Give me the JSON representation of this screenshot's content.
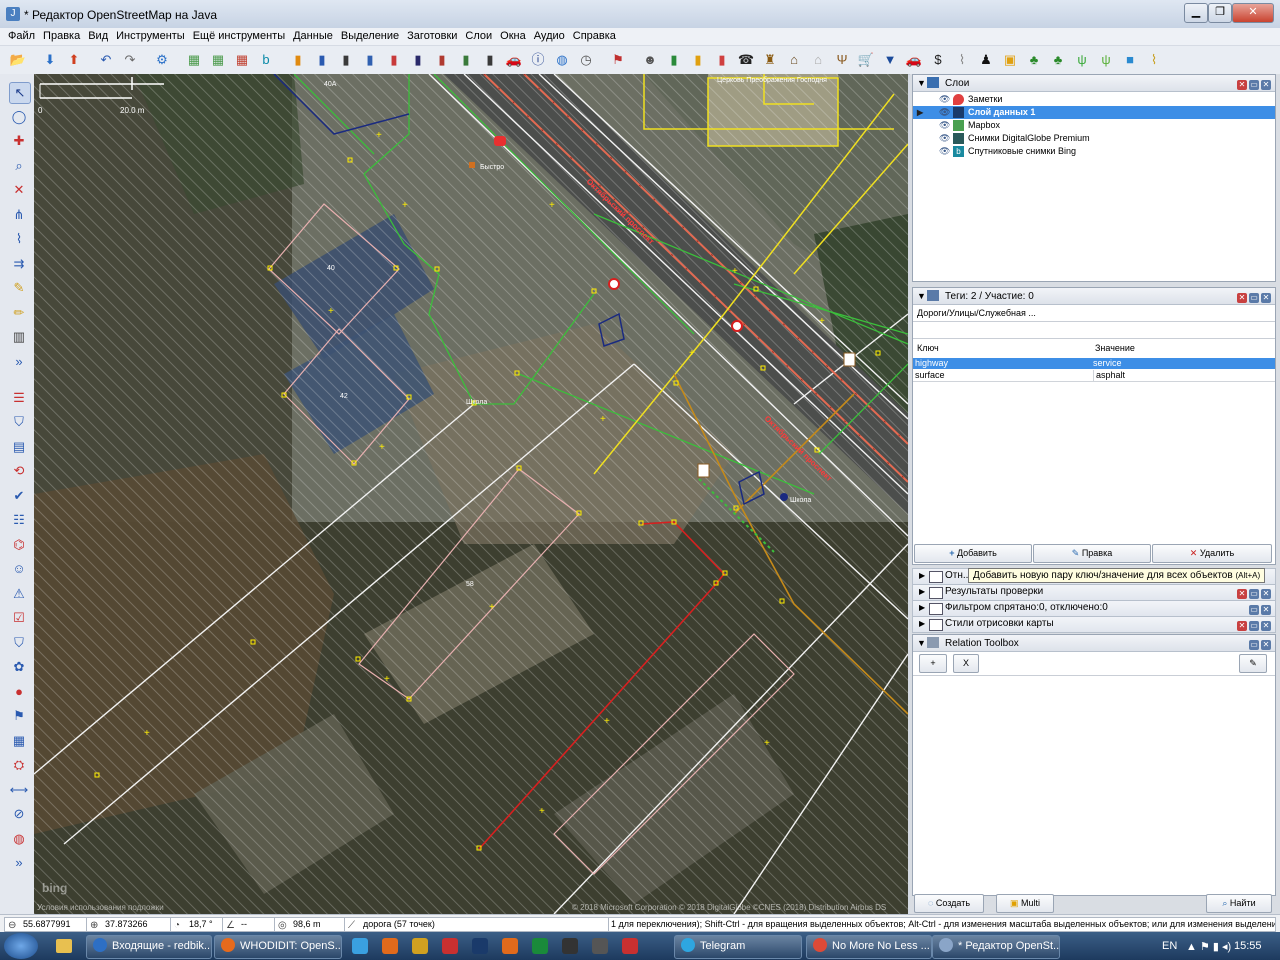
{
  "window": {
    "title": "* Редактор OpenStreetMap на Java",
    "app_icon": "josm-icon",
    "controls": [
      "minimize",
      "maximize",
      "close"
    ]
  },
  "menu": [
    "Файл",
    "Правка",
    "Вид",
    "Инструменты",
    "Ещё инструменты",
    "Данные",
    "Выделение",
    "Заготовки",
    "Слои",
    "Окна",
    "Аудио",
    "Справка"
  ],
  "toolbar_icons": [
    "open-icon",
    "download-icon",
    "upload-icon",
    "undo-icon",
    "redo-icon",
    "preferences-icon",
    "imagery-icon",
    "imagery-icon",
    "imagery-icon",
    "bing-icon",
    "preset-icon",
    "preset-icon",
    "preset-icon",
    "preset-icon",
    "preset-icon",
    "preset-icon",
    "preset-icon",
    "preset-icon",
    "preset-icon",
    "car-icon",
    "info-icon",
    "globe-icon",
    "clock-icon",
    "flag-icon",
    "theatre-icon",
    "preset-icon",
    "preset-icon",
    "preset-icon",
    "phone-icon",
    "castle-icon",
    "factory-icon",
    "house-icon",
    "fork-icon",
    "cart-icon",
    "shirt-icon",
    "car-icon",
    "dollar-icon",
    "clip-icon",
    "person-icon",
    "bag-icon",
    "tree-icon",
    "tree-icon",
    "grass-icon",
    "grass-icon",
    "square-icon",
    "wheat-icon"
  ],
  "left_tools": [
    "select-icon",
    "lasso-icon",
    "draw-icon",
    "zoom-icon",
    "delete-icon",
    "combine-icon",
    "split-icon",
    "parallel-icon",
    "ruler-icon",
    "pencil-icon",
    "building-icon",
    "expand-icon",
    "layers-icon",
    "filter-icon",
    "select-dialog-icon",
    "history-icon",
    "validator-icon",
    "tags-icon",
    "relations-icon",
    "author-icon",
    "conflict-icon",
    "validation-icon",
    "filters-icon",
    "style-icon",
    "notes-icon",
    "note-icon",
    "imagery-icon",
    "relation-toolbox-icon",
    "changeset-icon",
    "shortcut-icon",
    "globe-icon",
    "expand-icon"
  ],
  "map": {
    "scale_label": "20.0 m",
    "scale_zero": "0",
    "labels": {
      "church": "Церковь Преображения Господня",
      "street1": "Октябрьский проспект",
      "street2": "Октябрьский проспект",
      "house_40a": "40А",
      "house_40": "40",
      "house_42": "42",
      "house_58": "58",
      "school1": "Школа",
      "school2": "Школа",
      "shop": "Быстро",
      "bing": "bing"
    },
    "attribution_left": "Условия использования подложки",
    "attribution_right": "© 2018 Microsoft Corporation © 2018 DigitalGlobe ©CNES (2018) Distribution Airbus DS"
  },
  "layers_panel": {
    "title": "Слои",
    "items": [
      {
        "name": "Заметки",
        "icon": "notes-icon",
        "selected": false
      },
      {
        "name": "Слой данных 1",
        "icon": "data-layer-icon",
        "selected": true
      },
      {
        "name": "Mapbox",
        "icon": "mapbox-icon",
        "selected": false
      },
      {
        "name": "Снимки DigitalGlobe Premium",
        "icon": "imagery-icon",
        "selected": false
      },
      {
        "name": "Спутниковые снимки Bing",
        "icon": "bing-icon",
        "selected": false
      }
    ]
  },
  "tags_panel": {
    "title": "Теги: 2 / Участие: 0",
    "preset": "Дороги/Улицы/Служебная ...",
    "col_key": "Ключ",
    "col_value": "Значение",
    "rows": [
      {
        "key": "highway",
        "value": "service"
      },
      {
        "key": "surface",
        "value": "asphalt"
      }
    ],
    "btn_add": "Добавить",
    "btn_edit": "Правка",
    "btn_delete": "Удалить",
    "tooltip": "Добавить новую пару ключ/значение для всех объектов",
    "tooltip_shortcut": "(Alt+A)"
  },
  "collapsed_panels": [
    {
      "label": "Отн...",
      "icon": "relations-icon"
    },
    {
      "label": "Результаты проверки",
      "icon": "validator-icon"
    },
    {
      "label": "Фильтром спрятано:0, отключено:0",
      "icon": "filter-icon"
    },
    {
      "label": "Стили отрисовки карты",
      "icon": "style-icon"
    }
  ],
  "relation_toolbox": {
    "title": "Relation Toolbox",
    "btn_add": "+",
    "btn_x": "X",
    "btn_edit": "✎"
  },
  "bottom_buttons": {
    "create": "Создать",
    "multi": "Multi",
    "find": "Найти"
  },
  "status": {
    "lat": "55.6877991",
    "lon": "37.873266",
    "heading": "18,7 °",
    "angle": "--",
    "distance": "98,6 m",
    "selection": "дорога (57 точек)",
    "help": "1 для переключения); Shift-Ctrl - для вращения выделенных объектов; Alt-Ctrl - для изменения масштаба выделенных объектов; или для изменения выделения"
  },
  "taskbar": {
    "tasks": [
      {
        "label": "Входящие - redbik...",
        "color": "#2d6fc4"
      },
      {
        "label": "WHODIDIT: OpenS...",
        "color": "#e66a1c"
      },
      {
        "label": "Telegram",
        "color": "#2ea6e0"
      },
      {
        "label": "No More No Less ...",
        "color": "#dd4a37"
      },
      {
        "label": "* Редактор OpenSt...",
        "color": "#8aa5c8"
      }
    ],
    "lang": "EN",
    "time": "15:55"
  },
  "colors": {
    "accent": "#3d8ee6",
    "road_primary": "#e36a52",
    "road_green": "#3bbf3b",
    "building_outline": "#e8b0b0",
    "selected_way": "#d81f1f",
    "yellow_way": "#f0e020"
  }
}
